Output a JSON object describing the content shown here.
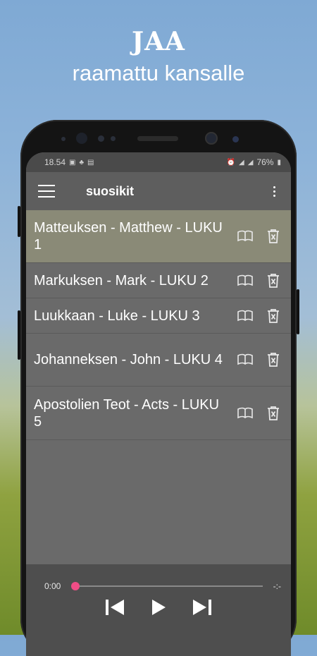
{
  "promo": {
    "logo": "JAA",
    "tagline": "raamattu kansalle"
  },
  "status_bar": {
    "time": "18.54",
    "battery": "76%"
  },
  "app_bar": {
    "title": "suosikit"
  },
  "favorites": [
    {
      "label": "Matteuksen - Matthew - LUKU 1",
      "selected": true
    },
    {
      "label": "Markuksen - Mark - LUKU 2",
      "selected": false
    },
    {
      "label": "Luukkaan - Luke - LUKU 3",
      "selected": false
    },
    {
      "label": "Johanneksen - John - LUKU 4",
      "selected": false
    },
    {
      "label": "Apostolien Teot - Acts - LUKU 5",
      "selected": false
    }
  ],
  "player": {
    "elapsed": "0:00",
    "duration": "-:-",
    "progress": 0
  },
  "colors": {
    "accent": "#ef4d86",
    "selected_row": "#8a8a77",
    "appbar": "#5e5e5e"
  },
  "icons": {
    "row_open": "book-open-icon",
    "row_delete": "trash-icon",
    "previous": "skip-previous-icon",
    "play": "play-icon",
    "next": "skip-next-icon"
  }
}
